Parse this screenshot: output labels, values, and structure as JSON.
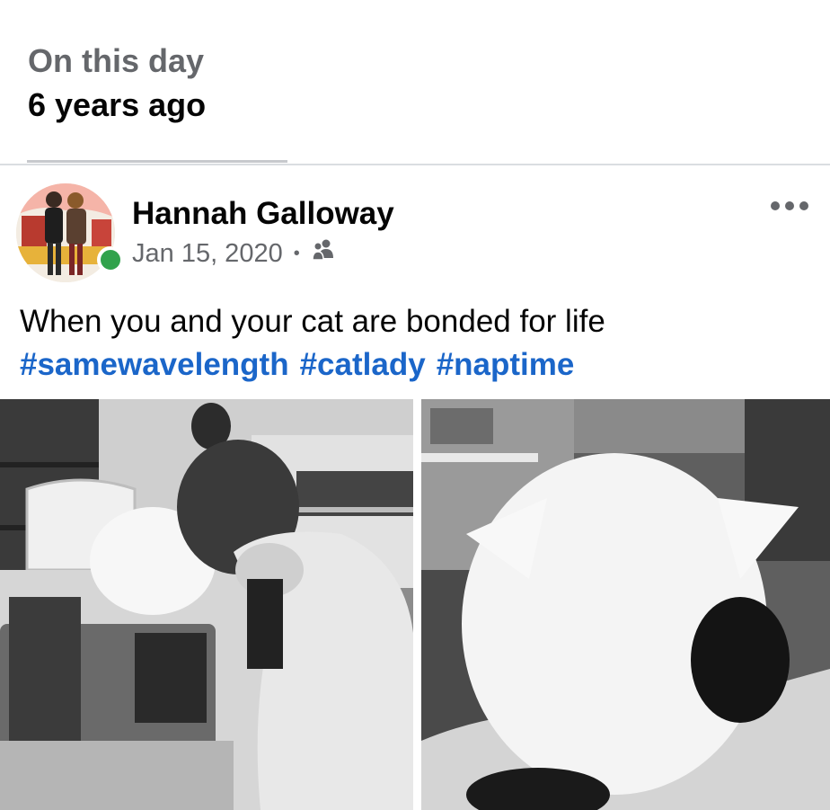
{
  "memory": {
    "label": "On this day",
    "time_ago": "6 years ago"
  },
  "post": {
    "author": "Hannah Galloway",
    "date": "Jan 15, 2020",
    "separator": "•",
    "audience_icon": "friends-icon",
    "text": "When you and your cat are bonded for life",
    "hashtags": [
      "#samewavelength",
      "#catlady",
      "#naptime"
    ]
  },
  "colors": {
    "link": "#1b66c9",
    "secondary_text": "#65676b",
    "online": "#31a24c"
  },
  "photos": [
    {
      "icon": "photo-woman-cat-typewriter"
    },
    {
      "icon": "photo-cat-closeup"
    }
  ]
}
